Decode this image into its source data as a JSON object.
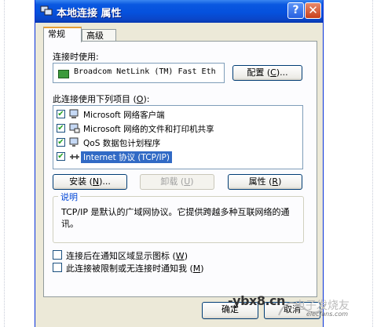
{
  "window": {
    "title": "本地连接 属性",
    "help_label": "?",
    "close_label": "✕"
  },
  "tabs": [
    {
      "label": "常规"
    },
    {
      "label": "高级"
    }
  ],
  "connect_using": {
    "label_prefix": "连接时使用",
    "label_suffix": ":",
    "adapter_name": "Broadcom NetLink (TM) Fast Eth",
    "configure_prefix": "配置 (",
    "configure_key": "C",
    "configure_suffix": ")..."
  },
  "items_section": {
    "label_prefix": "此连接使用下列项目 (",
    "label_key": "O",
    "label_suffix": "):",
    "items": [
      {
        "label": "Microsoft 网络客户端",
        "checked": true,
        "icon": "network-client-icon"
      },
      {
        "label": "Microsoft 网络的文件和打印机共享",
        "checked": true,
        "icon": "file-printer-sharing-icon"
      },
      {
        "label": "QoS 数据包计划程序",
        "checked": true,
        "icon": "qos-scheduler-icon"
      },
      {
        "label": "Internet 协议 (TCP/IP)",
        "checked": true,
        "icon": "protocol-icon",
        "selected": true
      }
    ]
  },
  "buttons": {
    "install_prefix": "安装 (",
    "install_key": "N",
    "install_suffix": ")...",
    "uninstall_prefix": "卸载 (",
    "uninstall_key": "U",
    "uninstall_suffix": ")",
    "properties_prefix": "属性 (",
    "properties_key": "R",
    "properties_suffix": ")",
    "ok": "确定",
    "cancel": "取消"
  },
  "description": {
    "title": "说明",
    "text": "TCP/IP 是默认的广域网协议。它提供跨越多种互联网络的通讯。"
  },
  "options": [
    {
      "prefix": "连接后在通知区域显示图标 (",
      "key": "W",
      "suffix": ")",
      "checked": false
    },
    {
      "prefix": "此连接被限制或无连接时通知我 (",
      "key": "M",
      "suffix": ")",
      "checked": false
    }
  ],
  "watermark": {
    "text": "-ybx8.cn",
    "logo_text": "elecfans.com"
  },
  "colors": {
    "title_bar": "#0551dd",
    "selection": "#316ac5",
    "dialog_bg": "#ece9d8",
    "tab_highlight": "#e69f36"
  }
}
